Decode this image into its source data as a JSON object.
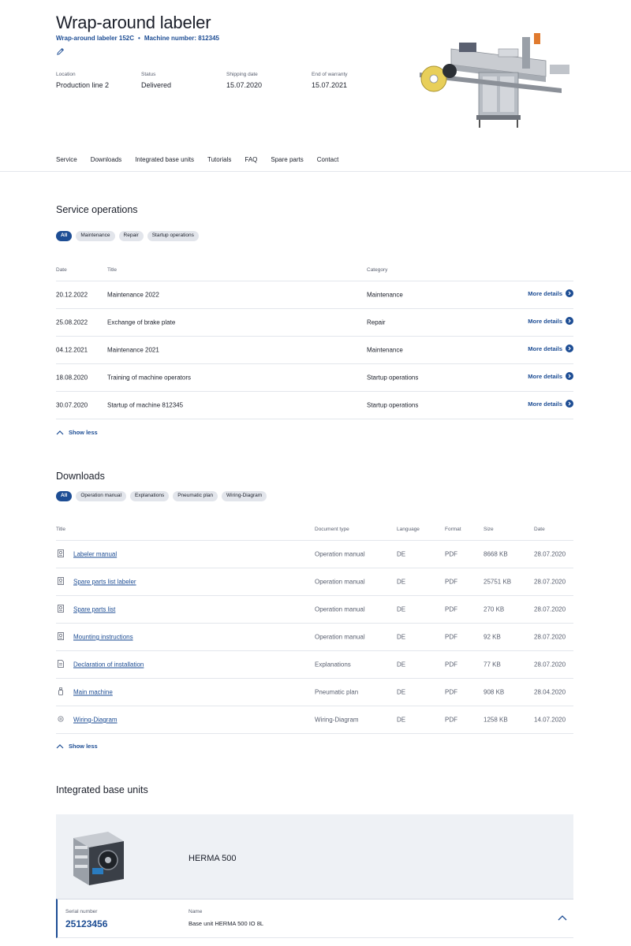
{
  "header": {
    "title": "Wrap-around labeler",
    "model": "Wrap-around labeler 152C",
    "machine_number": "Machine number: 812345",
    "meta": [
      {
        "label": "Location",
        "value": "Production line 2"
      },
      {
        "label": "Status",
        "value": "Delivered"
      },
      {
        "label": "Shipping date",
        "value": "15.07.2020"
      },
      {
        "label": "End of warranty",
        "value": "15.07.2021"
      }
    ]
  },
  "tabs": [
    "Service",
    "Downloads",
    "Integrated base units",
    "Tutorials",
    "FAQ",
    "Spare parts",
    "Contact"
  ],
  "service": {
    "title": "Service operations",
    "filters": [
      "All",
      "Maintenance",
      "Repair",
      "Startup operations"
    ],
    "columns": {
      "date": "Date",
      "title": "Title",
      "category": "Category"
    },
    "more_label": "More details",
    "rows": [
      {
        "date": "20.12.2022",
        "title": "Maintenance 2022",
        "category": "Maintenance"
      },
      {
        "date": "25.08.2022",
        "title": "Exchange of brake plate",
        "category": "Repair"
      },
      {
        "date": "04.12.2021",
        "title": "Maintenance 2021",
        "category": "Maintenance"
      },
      {
        "date": "18.08.2020",
        "title": "Training of machine operators",
        "category": "Startup operations"
      },
      {
        "date": "30.07.2020",
        "title": "Startup of machine 812345",
        "category": "Startup operations"
      }
    ],
    "show_less": "Show less"
  },
  "downloads": {
    "title": "Downloads",
    "filters": [
      "All",
      "Operation manual",
      "Explanations",
      "Pneumatic plan",
      "Wiring-Diagram"
    ],
    "columns": {
      "title": "Title",
      "type": "Document type",
      "language": "Language",
      "format": "Format",
      "size": "Size",
      "date": "Date"
    },
    "rows": [
      {
        "icon": "manual-icon",
        "title": "Labeler manual",
        "type": "Operation manual",
        "language": "DE",
        "format": "PDF",
        "size": "8668 KB",
        "date": "28.07.2020"
      },
      {
        "icon": "manual-icon",
        "title": "Spare parts list labeler",
        "type": "Operation manual",
        "language": "DE",
        "format": "PDF",
        "size": "25751 KB",
        "date": "28.07.2020"
      },
      {
        "icon": "manual-icon",
        "title": "Spare parts list",
        "type": "Operation manual",
        "language": "DE",
        "format": "PDF",
        "size": "270 KB",
        "date": "28.07.2020"
      },
      {
        "icon": "manual-icon",
        "title": "Mounting instructions",
        "type": "Operation manual",
        "language": "DE",
        "format": "PDF",
        "size": "92 KB",
        "date": "28.07.2020"
      },
      {
        "icon": "document-icon",
        "title": "Declaration of installation",
        "type": "Explanations",
        "language": "DE",
        "format": "PDF",
        "size": "77 KB",
        "date": "28.07.2020"
      },
      {
        "icon": "pneumatic-icon",
        "title": "Main machine",
        "type": "Pneumatic plan",
        "language": "DE",
        "format": "PDF",
        "size": "908 KB",
        "date": "28.04.2020"
      },
      {
        "icon": "wiring-icon",
        "title": "Wiring-Diagram",
        "type": "Wiring-Diagram",
        "language": "DE",
        "format": "PDF",
        "size": "1258 KB",
        "date": "14.07.2020"
      }
    ],
    "show_less": "Show less"
  },
  "base_units": {
    "title": "Integrated base units",
    "unit_name": "HERMA 500",
    "serial_label": "Serial number",
    "serial_value": "25123456",
    "name_label": "Name",
    "name_value": "Base unit HERMA 500 IO 8L"
  },
  "colors": {
    "accent": "#1d4d94",
    "chip_bg": "#e2e5eb",
    "card_bg": "#eef1f5",
    "divider": "#e3e6ec"
  }
}
